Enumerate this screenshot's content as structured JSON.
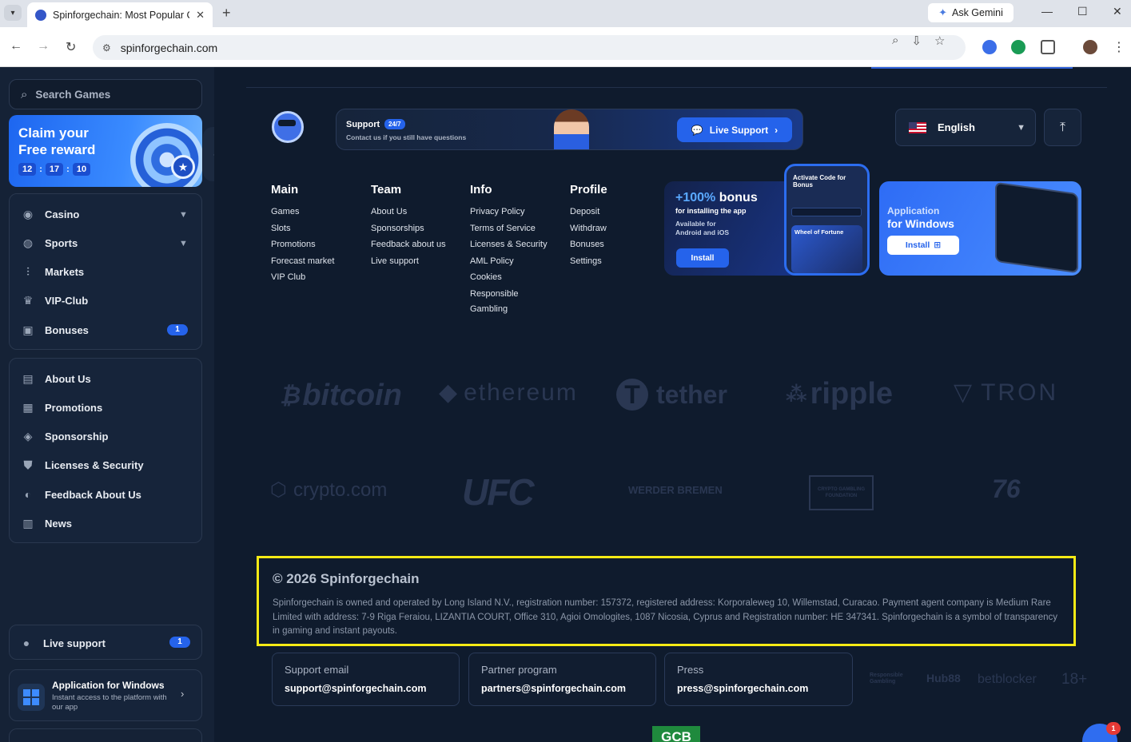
{
  "browser": {
    "tab_title": "Spinforgechain: Most Popular C",
    "url": "spinforgechain.com",
    "gemini_label": "Ask Gemini"
  },
  "sidebar": {
    "search_placeholder": "Search Games",
    "reward": {
      "title": "Claim your Free reward",
      "hours": "12",
      "minutes": "17",
      "seconds": "10"
    },
    "menu1": [
      {
        "label": "Casino",
        "icon": "casino-chip-icon"
      },
      {
        "label": "Sports",
        "icon": "sports-ball-icon"
      },
      {
        "label": "Markets",
        "icon": "markets-icon"
      },
      {
        "label": "VIP-Club",
        "icon": "crown-icon"
      },
      {
        "label": "Bonuses",
        "icon": "gift-icon",
        "badge": "1"
      }
    ],
    "menu2": [
      {
        "label": "About Us",
        "icon": "book-icon"
      },
      {
        "label": "Promotions",
        "icon": "promotions-icon"
      },
      {
        "label": "Sponsorship",
        "icon": "sponsorship-icon"
      },
      {
        "label": "Licenses & Security",
        "icon": "shield-icon"
      },
      {
        "label": "Feedback About Us",
        "icon": "feedback-icon"
      },
      {
        "label": "News",
        "icon": "news-icon"
      }
    ],
    "live_support": {
      "label": "Live support",
      "badge": "1"
    },
    "app_windows": {
      "title": "Application for Windows",
      "subtitle": "Instant access to the platform with our app"
    }
  },
  "header": {
    "support_title": "Support",
    "support_badge": "24/7",
    "support_subtitle": "Contact us if you still have questions",
    "live_support_button": "Live Support",
    "language": "English"
  },
  "footer_columns": [
    {
      "title": "Main",
      "links": [
        "Games",
        "Slots",
        "Promotions",
        "Forecast market",
        "VIP Club"
      ]
    },
    {
      "title": "Team",
      "links": [
        "About Us",
        "Sponsorships",
        "Feedback about us",
        "Live support"
      ]
    },
    {
      "title": "Info",
      "links": [
        "Privacy Policy",
        "Terms of Service",
        "Licenses & Security",
        "AML Policy",
        "Cookies",
        "Responsible",
        "Gambling"
      ]
    },
    {
      "title": "Profile",
      "links": [
        "Deposit",
        "Withdraw",
        "Bonuses",
        "Settings"
      ]
    }
  ],
  "promo_app": {
    "percent": "+100%",
    "bonus": "bonus",
    "subtitle": "for installing the app",
    "available": "Available for Android and iOS",
    "install": "Install",
    "phone_title": "Activate Code for Bonus",
    "phone_wheel": "Wheel of Fortune"
  },
  "promo_windows": {
    "line1": "Application",
    "line2": "for Windows",
    "install": "Install"
  },
  "partner_logos_row1": [
    "bitcoin",
    "ethereum",
    "tether",
    "ripple",
    "TRON"
  ],
  "partner_logos_row2": [
    "crypto.com",
    "UFC",
    "WERDER BREMEN",
    "CRYPTO GAMBLING FOUNDATION",
    "76"
  ],
  "legal": {
    "copyright": "© 2026 Spinforgechain",
    "text": "Spinforgechain is owned and operated by Long Island N.V., registration number: 157372, registered address: Korporaleweg 10, Willemstad, Curacao. Payment agent company is Medium Rare Limited with address: 7-9 Riga Feraiou, LIZANTIA COURT, Office 310, Agioi Omologites, 1087 Nicosia, Cyprus and Registration number: HE 347341. Spinforgechain is a symbol of transparency in gaming and instant payouts."
  },
  "contacts": [
    {
      "label": "Support email",
      "value": "support@spinforgechain.com"
    },
    {
      "label": "Partner program",
      "value": "partners@spinforgechain.com"
    },
    {
      "label": "Press",
      "value": "press@spinforgechain.com"
    }
  ],
  "rg_logos": [
    "Responsible Gambling",
    "Hub88",
    "betblocker",
    "18+"
  ],
  "gcb": "GCB",
  "chat_badge": "1",
  "colors": {
    "accent": "#2563eb",
    "highlight": "#f5ea15",
    "background": "#0f1b2d"
  }
}
